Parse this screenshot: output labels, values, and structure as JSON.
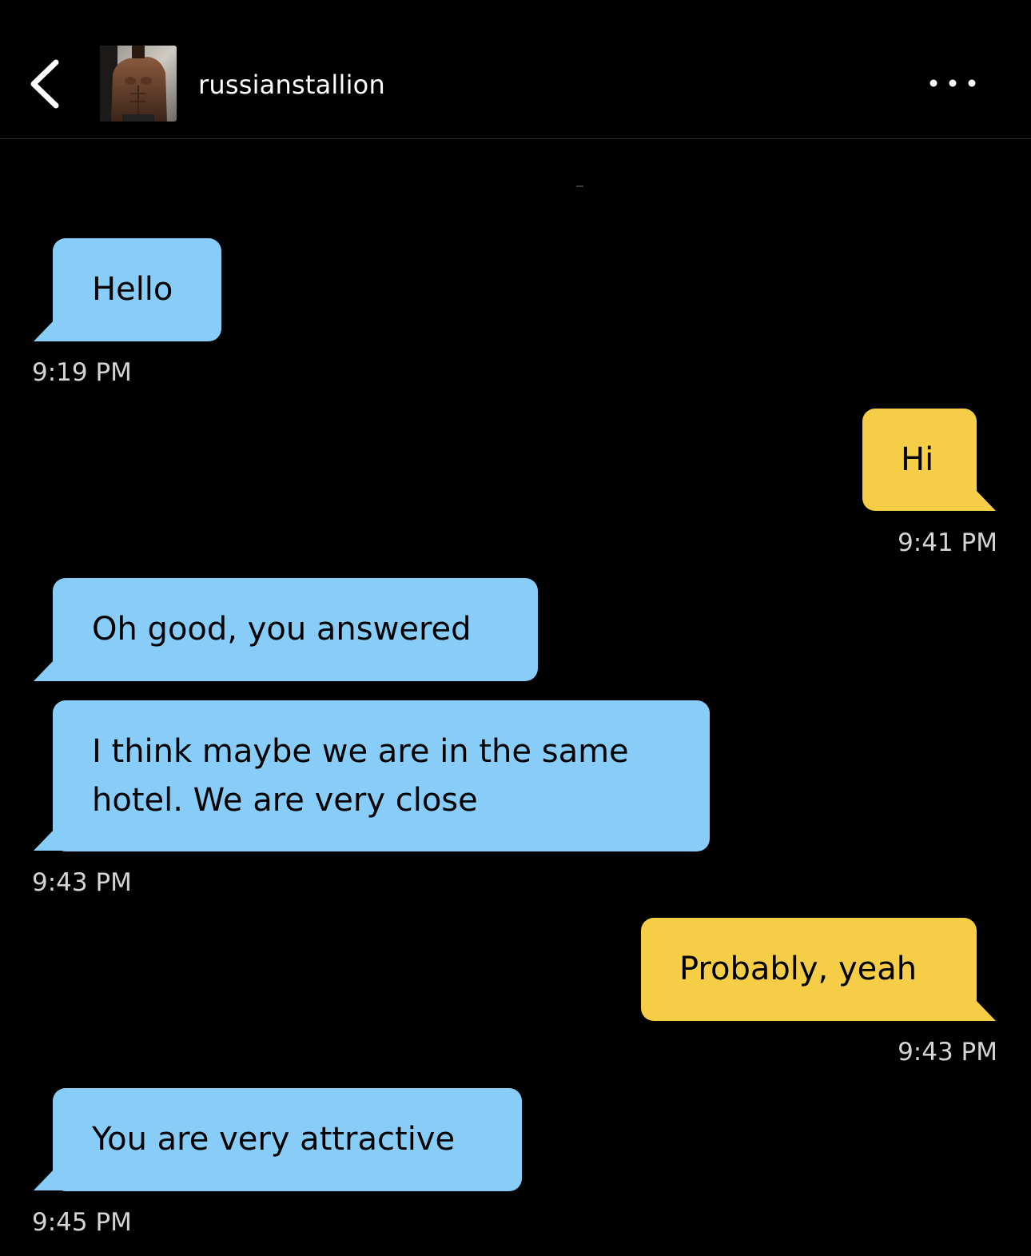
{
  "header": {
    "back_icon": "chevron-left-icon",
    "avatar_alt": "profile photo",
    "username": "russianstallion",
    "more_icon": "more-horizontal-icon"
  },
  "colors": {
    "background": "#000000",
    "incoming_bubble": "#87cdf8",
    "outgoing_bubble": "#f5cd47",
    "timestamp": "#d4d4d4"
  },
  "messages": [
    {
      "direction": "incoming",
      "text": "Hello"
    },
    {
      "direction": "outgoing",
      "text": "Hi"
    },
    {
      "direction": "incoming",
      "text": "Oh good, you answered"
    },
    {
      "direction": "incoming",
      "text": "I think maybe we are in the same\nhotel. We are very close"
    },
    {
      "direction": "outgoing",
      "text": "Probably, yeah"
    },
    {
      "direction": "incoming",
      "text": "You are very attractive"
    }
  ],
  "timestamps": [
    "9:19 PM",
    "9:41 PM",
    "9:43 PM",
    "9:43 PM",
    "9:45 PM"
  ]
}
